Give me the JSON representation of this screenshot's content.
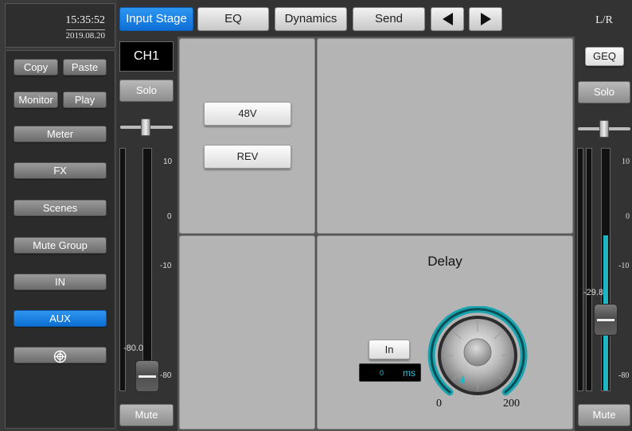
{
  "clock": {
    "time": "15:35:52",
    "date": "2019.08.20"
  },
  "sidebar": {
    "copy": "Copy",
    "paste": "Paste",
    "monitor": "Monitor",
    "play": "Play",
    "items": [
      "Meter",
      "FX",
      "Scenes",
      "Mute Group",
      "IN",
      "AUX"
    ],
    "active_item": "AUX",
    "extra_icon": "target-icon"
  },
  "tabs": {
    "items": [
      "Input Stage",
      "EQ",
      "Dynamics",
      "Send"
    ],
    "active": "Input Stage",
    "prev_icon": "triangle-left-icon",
    "next_icon": "triangle-right-icon"
  },
  "channel": {
    "name": "CH1",
    "solo": "Solo",
    "mute": "Mute",
    "scale": [
      "10",
      "0",
      "-10",
      "-80"
    ],
    "fader_value": "-80.0"
  },
  "input_stage": {
    "phantom": "48V",
    "reverse": "REV"
  },
  "delay": {
    "title": "Delay",
    "in_button": "In",
    "value": "0",
    "unit": "ms",
    "min": "0",
    "max": "200"
  },
  "master": {
    "name": "L/R",
    "geq": "GEQ",
    "solo": "Solo",
    "mute": "Mute",
    "scale": [
      "10",
      "0",
      "-10",
      "-80"
    ],
    "fader_value": "-29.8",
    "level_fraction": 0.64
  },
  "colors": {
    "accent": "#0d6fd6",
    "meter_teal": "#1fb6c4",
    "panel": "#b4b4b4"
  }
}
